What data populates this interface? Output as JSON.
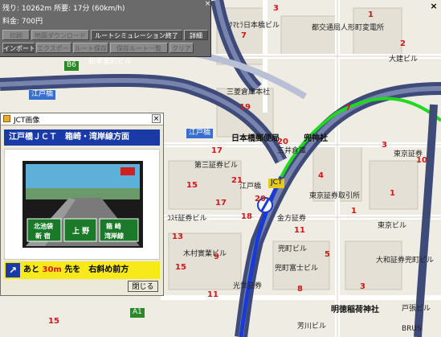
{
  "info": {
    "line1": "残り: 10262m  所要: 17分 (60km/h)",
    "line2": "料金: 700円",
    "buttons_row1": [
      "印刷",
      "地図ダウンロード",
      "ルートシミュレーション終了",
      "詳細"
    ],
    "buttons_row2": [
      "インポート",
      "エクスポート",
      "ルート保存",
      "保存ルート一覧",
      "クリア"
    ],
    "close": "×"
  },
  "map_close": "×",
  "dialog": {
    "title": "JCT画像",
    "close": "×",
    "header": "江戸橋ＪＣＴ　箱崎・湾岸線方面",
    "sign_left": "北池袋\n新 宿",
    "sign_mid": "上 野",
    "sign_right": "箱 崎\n湾岸線",
    "guide_prefix": "あと",
    "guide_distance": "30m",
    "guide_suffix": "先を　右斜め前方",
    "close_button": "閉じる"
  },
  "map": {
    "labels": [
      "ｸﾏﾋﾗ日本橋ビル",
      "都交通局人形町変電所",
      "江戸橋",
      "三菱倉庫本社",
      "日本橋郵便局",
      "兜神社",
      "三井倉庫",
      "東京証券取引所",
      "東京証券",
      "第三証券ビル",
      "江戸橋",
      "金方証券",
      "ｺｽﾓ証券ビル",
      "木村實業ビル",
      "兜町ビル",
      "兜町富士ビル",
      "大和証券兜町ビル",
      "光世証券",
      "明徳稲荷神社",
      "東京ビル",
      "和孝室町ビル",
      "芳川ビル",
      "戸張ビル",
      "大建ビル",
      "日本橋ビル",
      "日本橋",
      "日本橋第一",
      "BRUS"
    ],
    "road_labels": [
      "江戸橋",
      "江戸橋",
      "JCT"
    ],
    "route_labels": [
      "B6",
      "A1"
    ],
    "numbers": [
      "1",
      "2",
      "3",
      "4",
      "5",
      "6",
      "7",
      "8",
      "9",
      "10",
      "11",
      "12",
      "13",
      "14",
      "15",
      "16",
      "17",
      "18",
      "19",
      "20",
      "21"
    ]
  }
}
